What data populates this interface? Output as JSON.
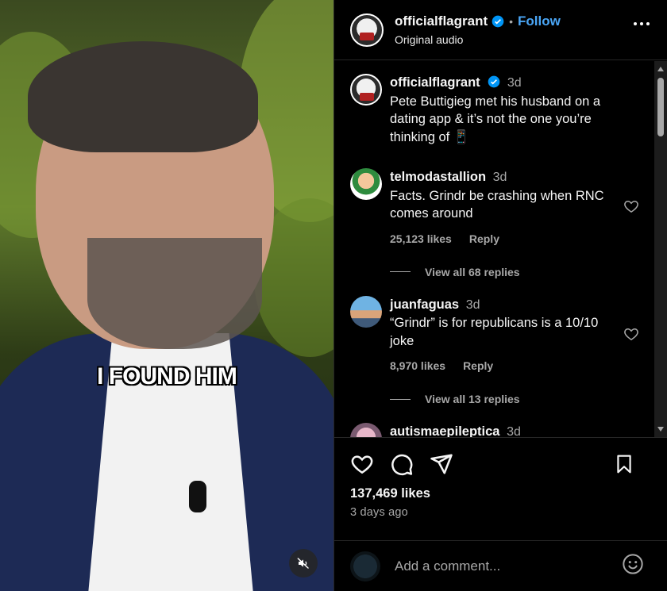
{
  "video": {
    "caption": "I FOUND HIM",
    "mute_icon": "speaker-muted-icon"
  },
  "header": {
    "username": "officialflagrant",
    "separator": "•",
    "follow_label": "Follow",
    "subtitle": "Original audio",
    "verified_color": "#0095f6"
  },
  "post": {
    "username": "officialflagrant",
    "time": "3d",
    "caption": "Pete Buttigieg met his husband on a dating app & it’s not the one you’re thinking of 📱"
  },
  "comments": [
    {
      "username": "telmodastallion",
      "time": "3d",
      "text": "Facts. Grindr be crashing when RNC comes around",
      "likes": "25,123 likes",
      "reply_label": "Reply",
      "view_replies": "View all 68 replies"
    },
    {
      "username": "juanfaguas",
      "time": "3d",
      "text": "“Grindr” is for republicans is a 10/10 joke",
      "likes": "8,970 likes",
      "reply_label": "Reply",
      "view_replies": "View all 13 replies"
    },
    {
      "username": "autismaepileptica",
      "time": "3d"
    }
  ],
  "actions": {
    "likes": "137,469 likes",
    "posted": "3 days ago"
  },
  "comment_box": {
    "placeholder": "Add a comment..."
  },
  "colors": {
    "background": "#000000",
    "accent": "#4aa6f6",
    "muted_text": "#a8a8a8",
    "divider": "#262626"
  }
}
